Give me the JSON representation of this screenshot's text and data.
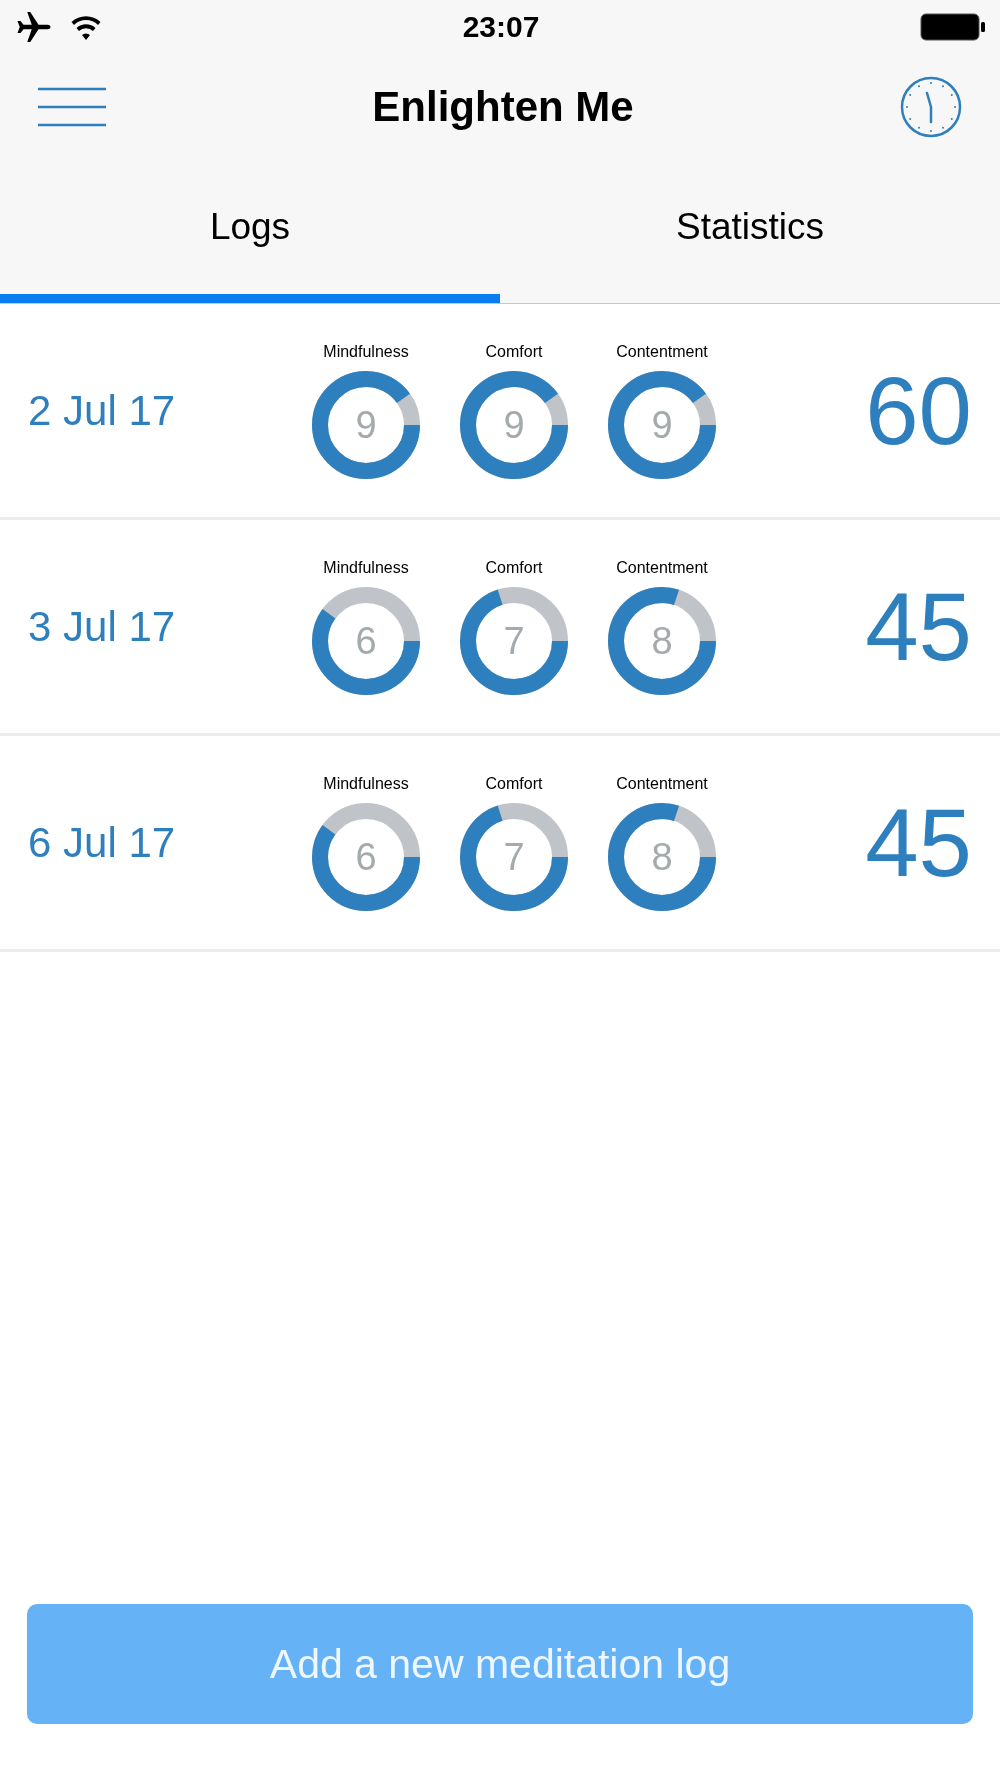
{
  "status_bar": {
    "time": "23:07"
  },
  "nav": {
    "title": "Enlighten Me"
  },
  "tabs": [
    {
      "label": "Logs",
      "selected": true
    },
    {
      "label": "Statistics",
      "selected": false
    }
  ],
  "logs": [
    {
      "date": "2 Jul 17",
      "minutes": "60",
      "scores": [
        {
          "label": "Mindfulness",
          "value": "9"
        },
        {
          "label": "Comfort",
          "value": "9"
        },
        {
          "label": "Contentment",
          "value": "9"
        }
      ]
    },
    {
      "date": "3 Jul 17",
      "minutes": "45",
      "scores": [
        {
          "label": "Mindfulness",
          "value": "6"
        },
        {
          "label": "Comfort",
          "value": "7"
        },
        {
          "label": "Contentment",
          "value": "8"
        }
      ]
    },
    {
      "date": "6 Jul 17",
      "minutes": "45",
      "scores": [
        {
          "label": "Mindfulness",
          "value": "6"
        },
        {
          "label": "Comfort",
          "value": "7"
        },
        {
          "label": "Contentment",
          "value": "8"
        }
      ]
    }
  ],
  "add_button": {
    "label": "Add a new meditation log"
  }
}
